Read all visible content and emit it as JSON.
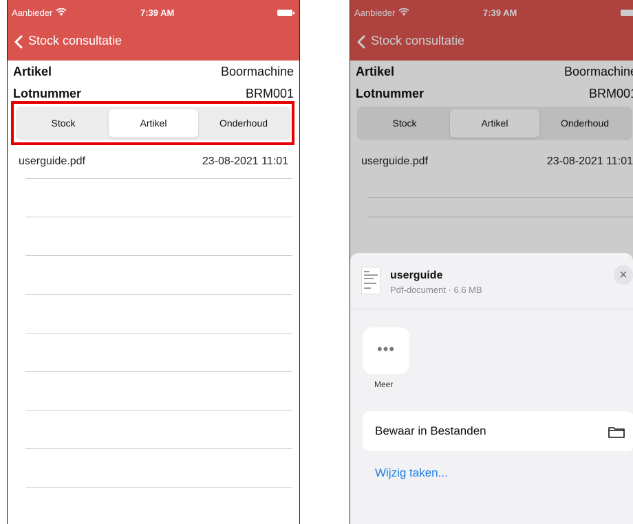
{
  "status": {
    "carrier": "Aanbieder",
    "time": "7:39 AM"
  },
  "nav": {
    "title": "Stock consultatie"
  },
  "details": {
    "article_label": "Artikel",
    "article_value": "Boormachine",
    "lot_label": "Lotnummer",
    "lot_value": "BRM001"
  },
  "tabs": [
    {
      "label": "Stock"
    },
    {
      "label": "Artikel",
      "selected": true
    },
    {
      "label": "Onderhoud"
    }
  ],
  "files": [
    {
      "name": "userguide.pdf",
      "date": "23-08-2021 11:01"
    }
  ],
  "share_sheet": {
    "title": "userguide",
    "subtitle": "Pdf-document · 6.6 MB",
    "close_icon": "×",
    "more_label": "Meer",
    "more_icon": "•••",
    "action_label": "Bewaar in Bestanden",
    "edit_label": "Wijzig taken..."
  },
  "colors": {
    "accent": "#d9534f",
    "highlight": "#e60000",
    "link": "#1f7fe5"
  }
}
